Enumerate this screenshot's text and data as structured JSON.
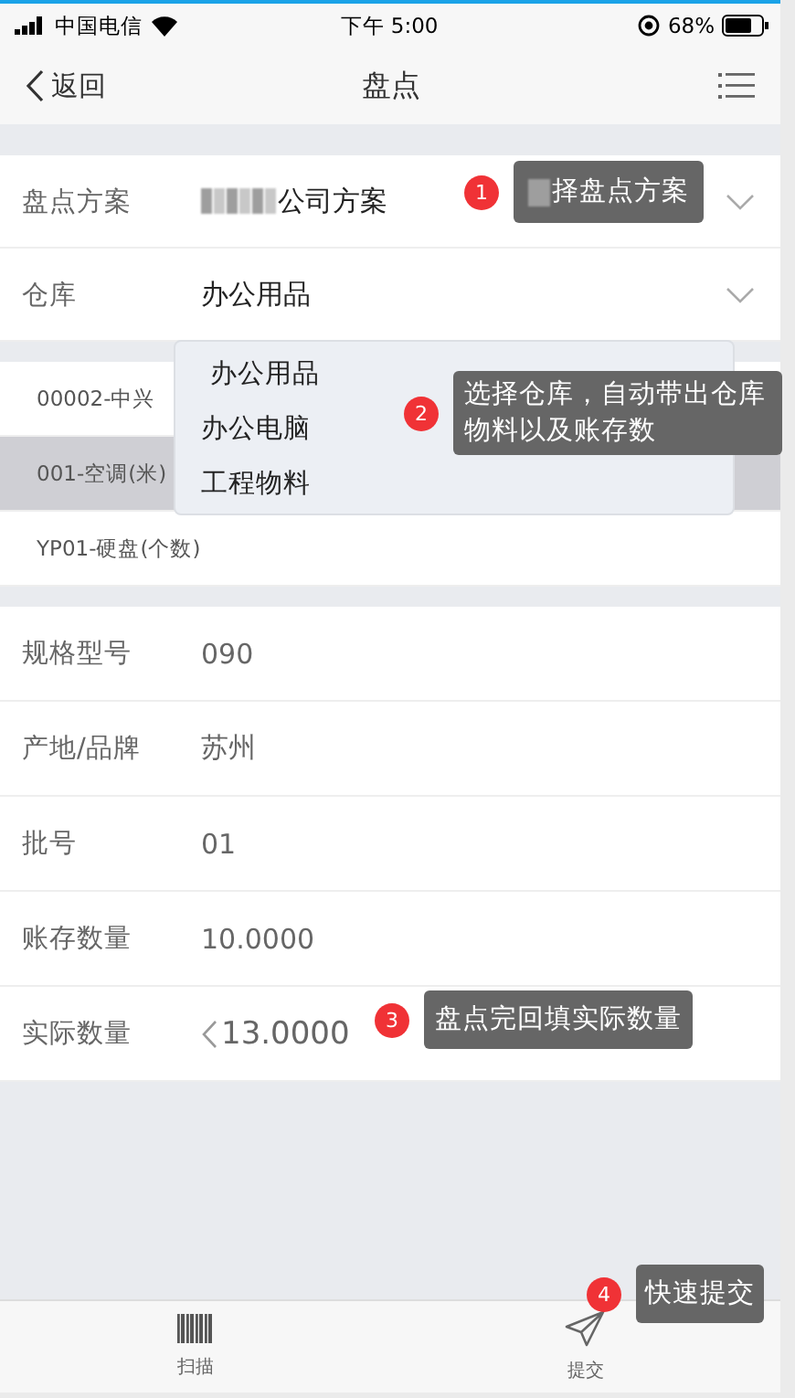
{
  "status_bar": {
    "carrier": "中国电信",
    "time": "下午 5:00",
    "battery": "68%"
  },
  "nav": {
    "back": "返回",
    "title": "盘点"
  },
  "form": [
    {
      "label": "盘点方案",
      "value": "公司方案",
      "blurred_prefix": true
    },
    {
      "label": "仓库",
      "value": "办公用品",
      "blurred_prefix": false
    }
  ],
  "materials": [
    {
      "name": "00002-中兴",
      "selected": false
    },
    {
      "name": "001-空调(米)",
      "selected": true
    },
    {
      "name": "YP01-硬盘(个数)",
      "selected": false
    }
  ],
  "dropdown": [
    {
      "label": "办公用品",
      "selected": true
    },
    {
      "label": "办公电脑",
      "selected": false
    },
    {
      "label": "工程物料",
      "selected": false
    }
  ],
  "details": [
    {
      "kind": "text",
      "label": "规格型号",
      "value": "090"
    },
    {
      "kind": "text",
      "label": "产地/品牌",
      "value": "苏州"
    },
    {
      "kind": "text",
      "label": "批号",
      "value": "01"
    },
    {
      "kind": "text",
      "label": "账存数量",
      "value": "10.0000"
    },
    {
      "kind": "input",
      "label": "实际数量",
      "value": "13.0000"
    }
  ],
  "tabs": [
    {
      "kind": "scan",
      "label": "扫描"
    },
    {
      "kind": "submit",
      "label": "提交"
    }
  ],
  "callouts": [
    {
      "number": "1",
      "text": "择盘点方案",
      "blurred_prefix": true
    },
    {
      "number": "2",
      "text": "选择仓库，自动带出仓库物料以及账存数",
      "blurred_prefix": false
    },
    {
      "number": "3",
      "text": "盘点完回填实际数量",
      "blurred_prefix": false
    },
    {
      "number": "4",
      "text": "快速提交",
      "blurred_prefix": false
    }
  ]
}
